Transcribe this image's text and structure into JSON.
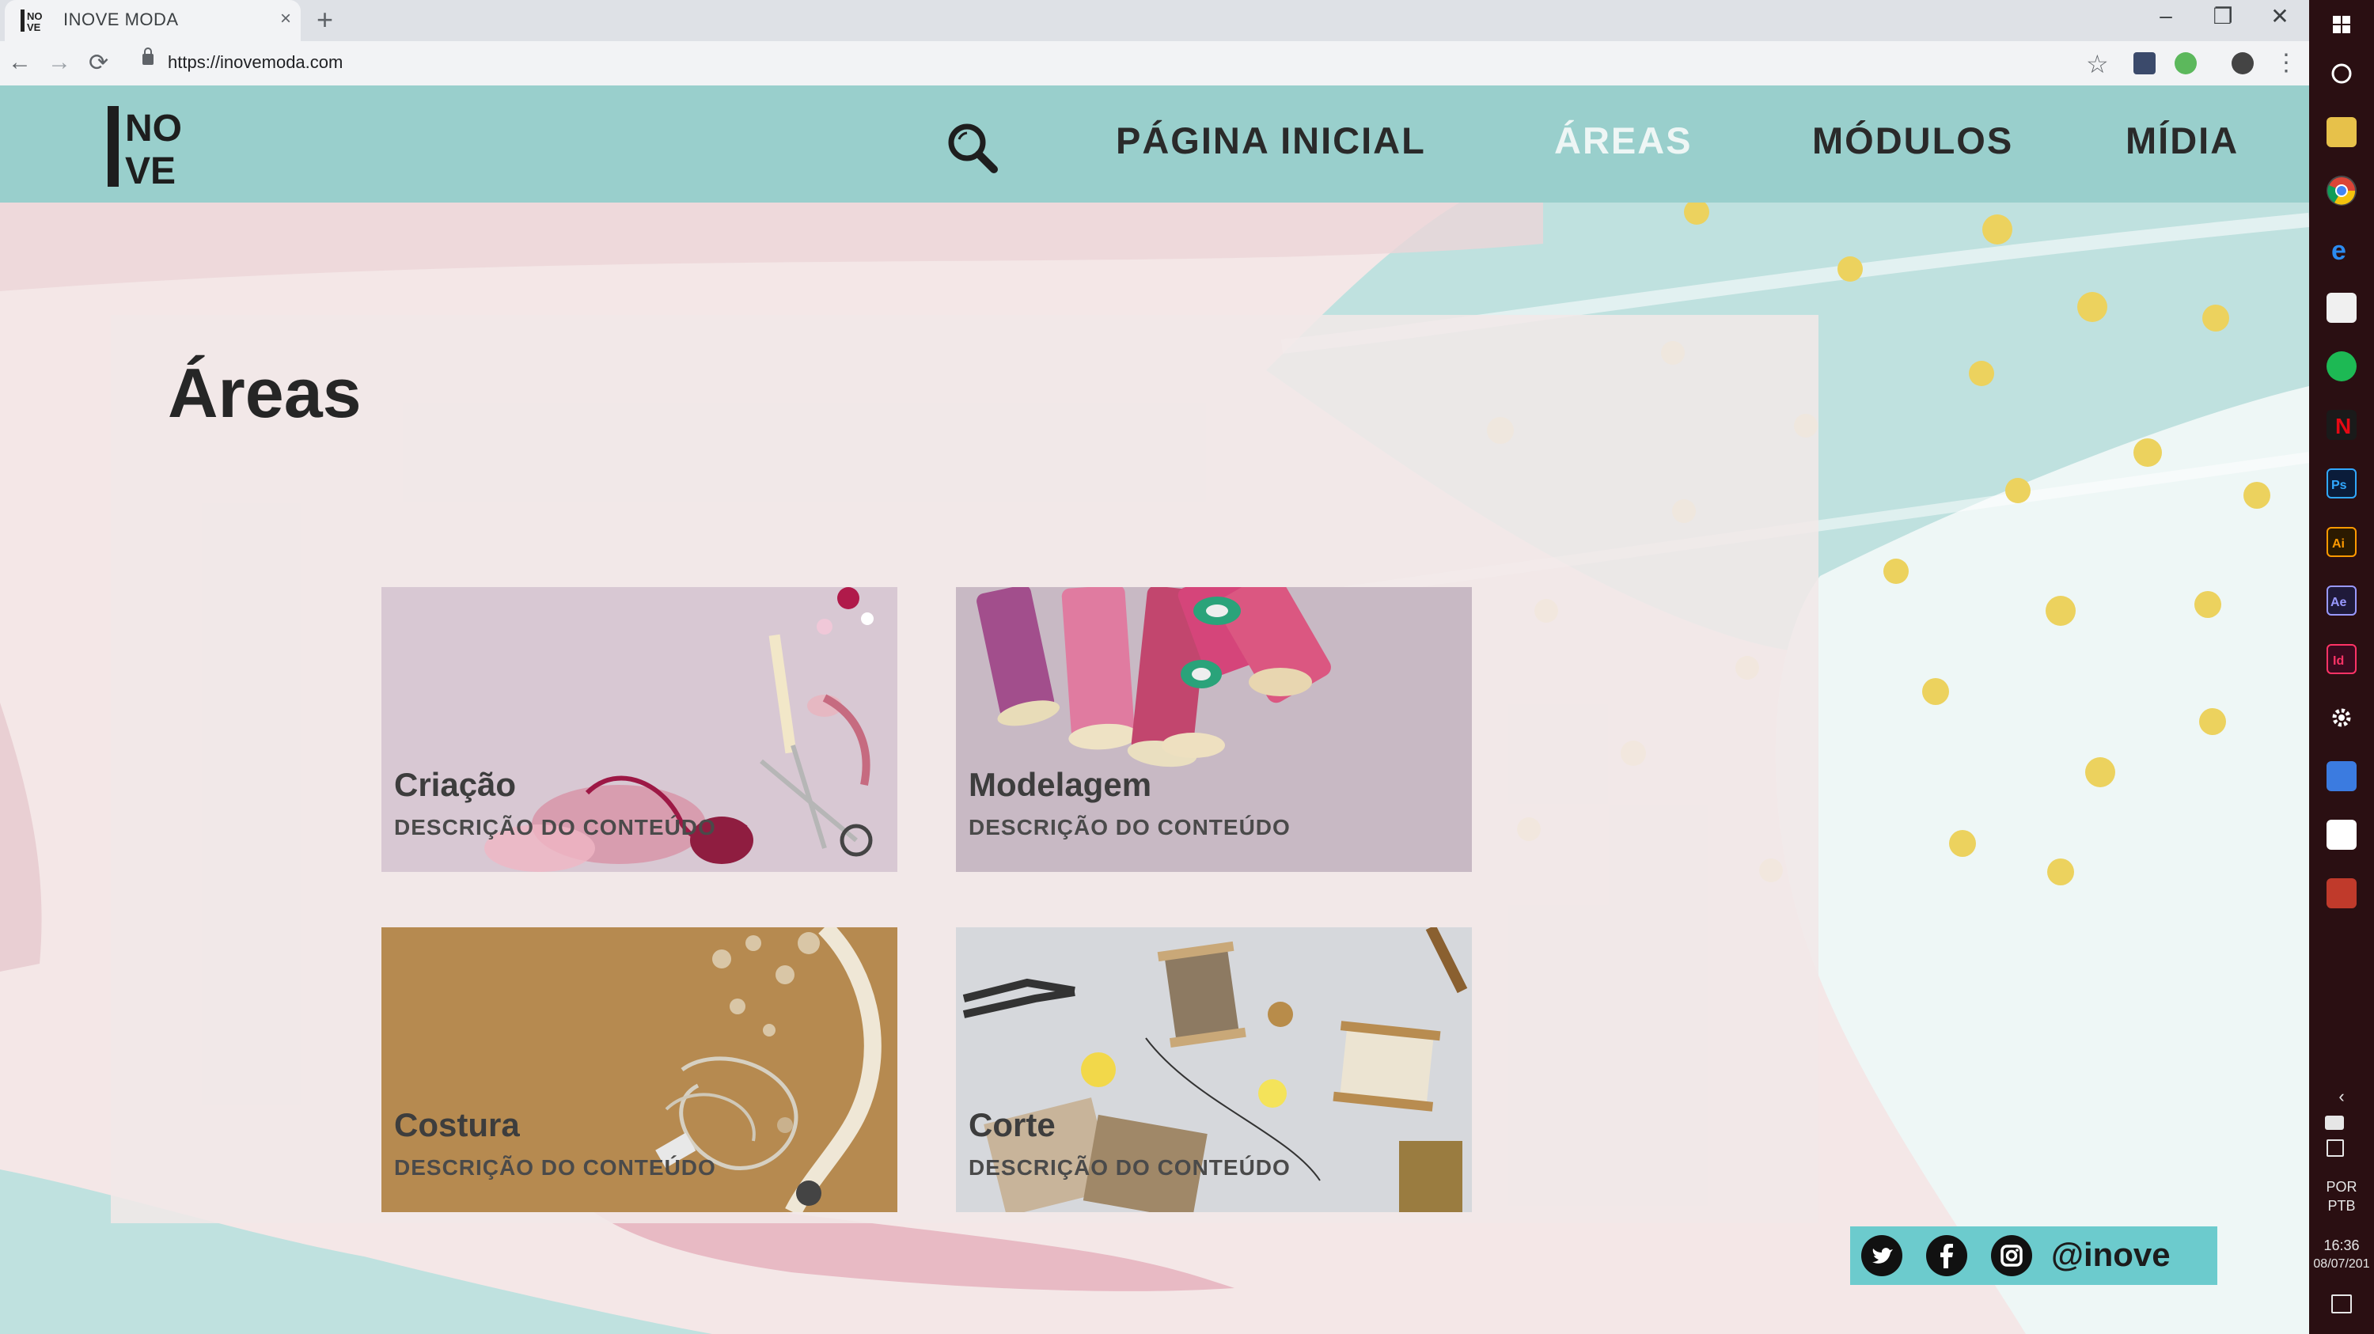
{
  "browser": {
    "tab_title": "INOVE MODA",
    "tab_close": "×",
    "new_tab": "+",
    "url": "https://inovemoda.com",
    "minimize": "–",
    "restore": "❐",
    "close": "✕",
    "back": "←",
    "forward": "→",
    "reload": "⟳",
    "star": "☆",
    "menu": "⋮"
  },
  "site": {
    "logo_icon": "inove-logo",
    "logo_text": "INOVE",
    "search_icon": "search-icon",
    "nav": [
      "PÁGINA INICIAL",
      "ÁREAS",
      "MÓDULOS",
      "MÍDIA"
    ],
    "active_nav": "ÁREAS",
    "page_title": "Áreas",
    "cards": [
      {
        "title": "Criação",
        "desc": "DESCRIÇÃO DO CONTEÚDO",
        "image": "sewing-notions-pink"
      },
      {
        "title": "Modelagem",
        "desc": "DESCRIÇÃO DO CONTEÚDO",
        "image": "thread-spools"
      },
      {
        "title": "Costura",
        "desc": "DESCRIÇÃO DO CONTEÚDO",
        "image": "buttons-tape-measure"
      },
      {
        "title": "Corte",
        "desc": "DESCRIÇÃO DO CONTEÚDO",
        "image": "spools-and-scissors"
      }
    ],
    "social": {
      "icons": [
        "twitter-icon",
        "facebook-icon",
        "instagram-icon"
      ],
      "handle": "@inove"
    }
  },
  "taskbar": {
    "language_1": "POR",
    "language_2": "PTB",
    "time": "16:36",
    "date": "08/07/201"
  },
  "colors": {
    "header": "#99cfcc",
    "teal_accent": "#6ccbcd",
    "background": "#f4e7e7",
    "dots": "#ecd25e",
    "taskbar": "#2a0f12"
  }
}
